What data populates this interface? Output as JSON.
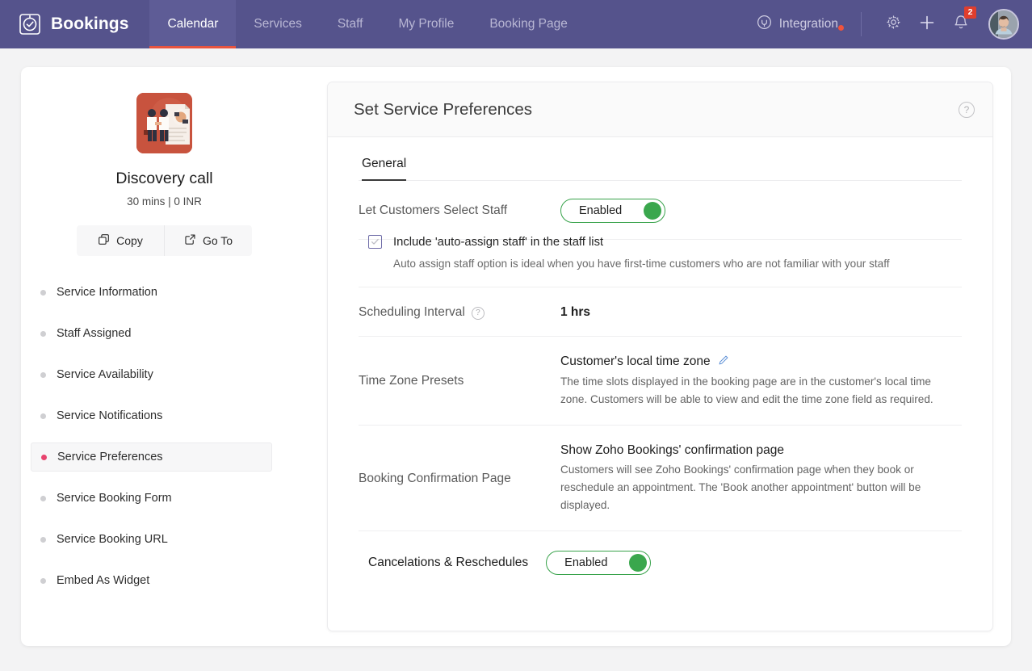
{
  "nav": {
    "brand": "Bookings",
    "brand_logo_icon": "clock-check-icon",
    "tabs": [
      {
        "label": "Calendar",
        "active": true
      },
      {
        "label": "Services",
        "active": false
      },
      {
        "label": "Staff",
        "active": false
      },
      {
        "label": "My Profile",
        "active": false
      },
      {
        "label": "Booking Page",
        "active": false
      }
    ],
    "integration": {
      "label": "Integration",
      "icon": "plug-icon",
      "has_new_dot": true
    },
    "settings_icon": "gear-icon",
    "add_icon": "plus-icon",
    "notifications_icon": "bell-icon",
    "notifications_count": "2",
    "avatar_icon": "user-avatar",
    "bar_color": "#55538c",
    "active_tab_underline_color": "#e8543f",
    "badge_color": "#e03e2d"
  },
  "sidebar": {
    "service_thumbnail_icon": "handshake-illustration",
    "service_name": "Discovery call",
    "service_meta": "30 mins | 0 INR",
    "actions": [
      {
        "label": "Copy",
        "icon": "copy-icon"
      },
      {
        "label": "Go To",
        "icon": "external-link-icon"
      }
    ],
    "items": [
      {
        "label": "Service Information",
        "active": false
      },
      {
        "label": "Staff Assigned",
        "active": false
      },
      {
        "label": "Service Availability",
        "active": false
      },
      {
        "label": "Service Notifications",
        "active": false
      },
      {
        "label": "Service Preferences",
        "active": true
      },
      {
        "label": "Service Booking Form",
        "active": false
      },
      {
        "label": "Service Booking URL",
        "active": false
      },
      {
        "label": "Embed As Widget",
        "active": false
      }
    ],
    "active_dot_color": "#e8446e"
  },
  "panel": {
    "title": "Set Service Preferences",
    "help_icon": "question-circle-icon",
    "tabs": [
      {
        "label": "General",
        "active": true
      }
    ],
    "rows": {
      "select_staff": {
        "label": "Let Customers Select Staff",
        "toggle_state": "Enabled",
        "toggle_color": "#3aa74d",
        "checkbox_checked": true,
        "checkbox_label": "Include 'auto-assign staff' in the staff list",
        "hint": "Auto assign staff option is ideal when you have first-time customers who are not familiar with your staff"
      },
      "scheduling_interval": {
        "label": "Scheduling Interval",
        "help_icon": "question-circle-icon",
        "value": "1 hrs"
      },
      "time_zone_presets": {
        "label": "Time Zone Presets",
        "value": "Customer's local time zone",
        "edit_icon": "pencil-icon",
        "description": "The time slots displayed in the booking page are in the customer's local time zone. Customers will be able to view and edit the time zone field as required."
      },
      "booking_confirmation_page": {
        "label": "Booking Confirmation Page",
        "value": "Show Zoho Bookings' confirmation page",
        "description": "Customers will see Zoho Bookings' confirmation page when they book or reschedule an appointment. The 'Book another appointment' button will be displayed."
      },
      "cancelations": {
        "label": "Cancelations & Reschedules",
        "toggle_state": "Enabled",
        "toggle_color": "#3aa74d"
      }
    }
  }
}
